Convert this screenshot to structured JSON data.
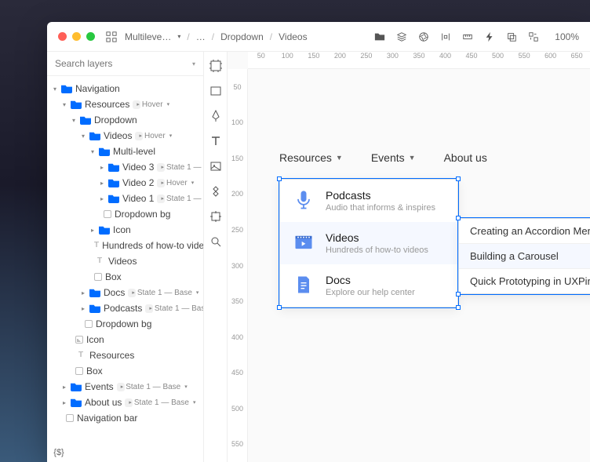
{
  "titlebar": {
    "breadcrumb": [
      "Multileve…",
      "…",
      "Dropdown",
      "Videos"
    ],
    "zoom": "100%"
  },
  "search": {
    "placeholder": "Search layers"
  },
  "states": {
    "base": "State 1 — Base",
    "hover": "Hover"
  },
  "layers": {
    "nav": "Navigation",
    "resources": "Resources",
    "dropdown": "Dropdown",
    "videos": "Videos",
    "multilevel": "Multi-level",
    "video3": "Video 3",
    "video2": "Video 2",
    "video1": "Video 1",
    "ddbg": "Dropdown bg",
    "icon": "Icon",
    "howto": "Hundreds of how-to videos",
    "videos_t": "Videos",
    "box": "Box",
    "docs": "Docs",
    "podcasts": "Podcasts",
    "ddbg2": "Dropdown bg",
    "icon2": "Icon",
    "resources_t": "Resources",
    "box2": "Box",
    "events": "Events",
    "about": "About us",
    "navbar": "Navigation bar"
  },
  "ruler_h": [
    "50",
    "100",
    "150",
    "200",
    "250",
    "300",
    "350",
    "400",
    "450",
    "500",
    "550",
    "600",
    "650"
  ],
  "ruler_v": [
    "50",
    "100",
    "150",
    "200",
    "250",
    "300",
    "350",
    "400",
    "450",
    "500",
    "550"
  ],
  "canvas": {
    "nav": {
      "resources": "Resources",
      "events": "Events",
      "about": "About us"
    },
    "dd1": [
      {
        "title": "Podcasts",
        "sub": "Audio that informs & inspires",
        "icon": "mic"
      },
      {
        "title": "Videos",
        "sub": "Hundreds of how-to videos",
        "icon": "film"
      },
      {
        "title": "Docs",
        "sub": "Explore our help center",
        "icon": "doc"
      }
    ],
    "dd2": [
      "Creating an Accordion Menu",
      "Building a Carousel",
      "Quick Prototyping in UXPin"
    ]
  },
  "rail_bottom": "{$}"
}
